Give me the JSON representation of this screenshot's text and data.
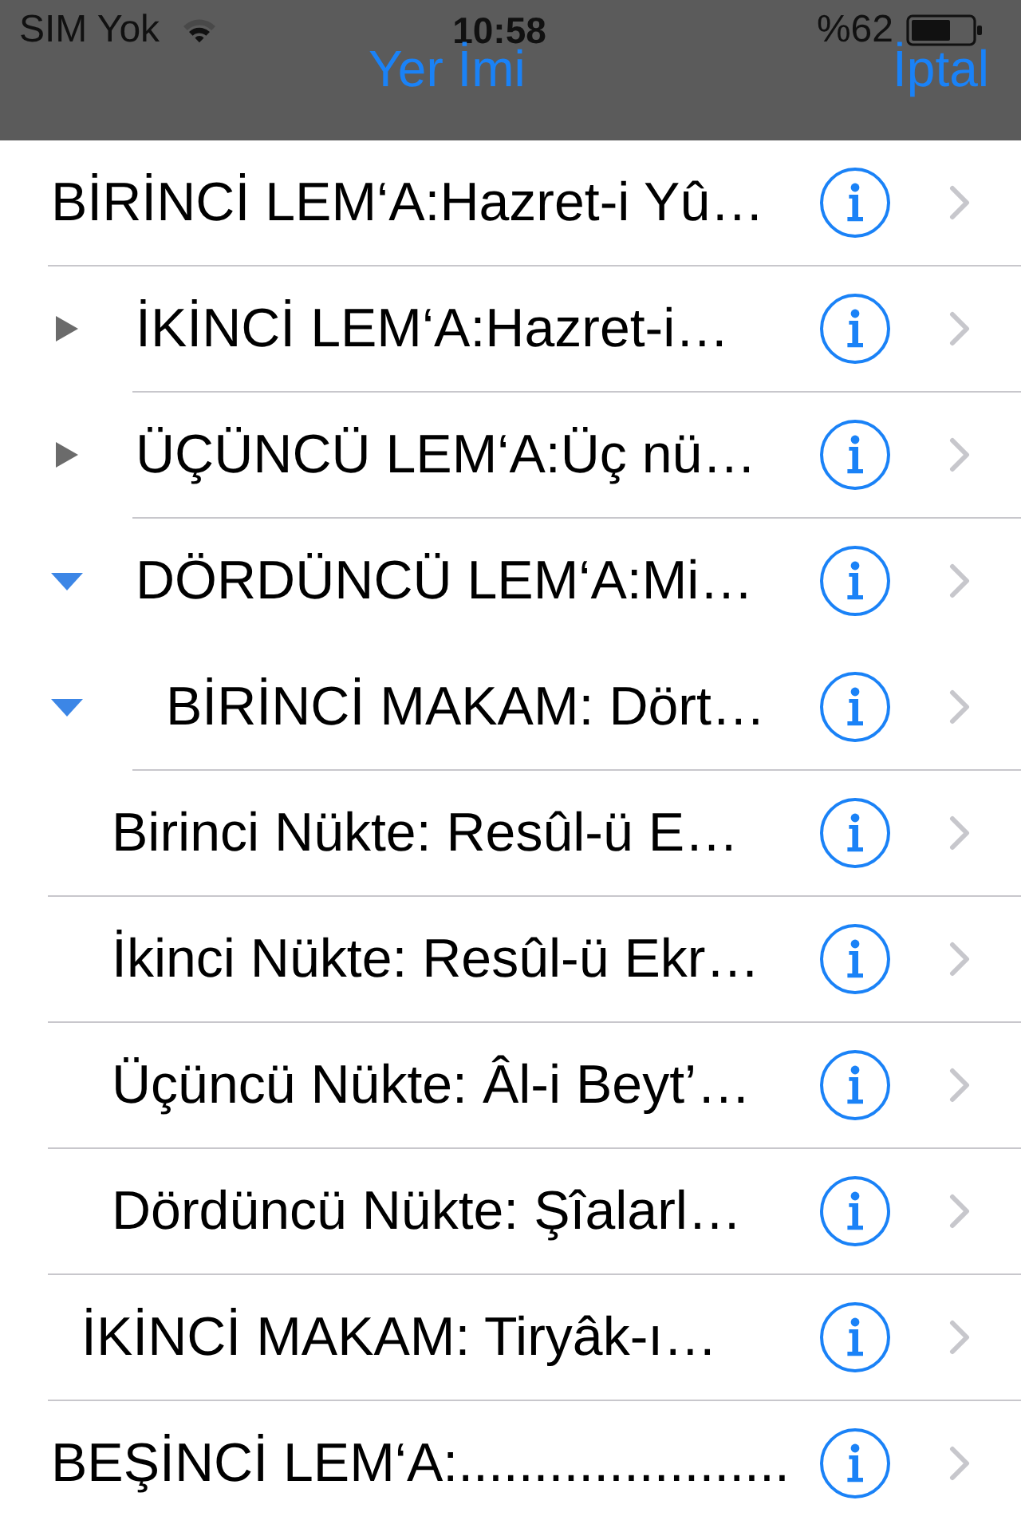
{
  "status_bar": {
    "carrier": "SIM Yok",
    "time": "10:58",
    "battery": "%62"
  },
  "nav_bar": {
    "title": "Yer İmi",
    "cancel": "İptal"
  },
  "outline": [
    {
      "title": "BİRİNCİ LEM‘A:Hazret-i Yû…",
      "separator": true
    },
    {
      "title": "İKİNCİ LEM‘A:Hazret-i…",
      "expanded": false,
      "separator": true
    },
    {
      "title": "ÜÇÜNCÜ LEM‘A:Üç nü…",
      "expanded": false,
      "separator": true
    },
    {
      "title": "DÖRDÜNCÜ LEM‘A:Mi…",
      "expanded": true,
      "separator": false,
      "children": [
        {
          "title": "BİRİNCİ MAKAM: Dört…",
          "expanded": true,
          "separator": true,
          "children": [
            {
              "title": "Birinci Nükte: Resûl-ü E…",
              "separator": true
            },
            {
              "title": "İkinci Nükte: Resûl-ü Ekr…",
              "separator": true
            },
            {
              "title": "Üçüncü Nükte: Âl-i Beyt’…",
              "separator": true
            },
            {
              "title": "Dördüncü Nükte: Şîalarl…",
              "separator": true
            }
          ]
        },
        {
          "title": "İKİNCİ MAKAM: Tiryâk-ı…",
          "separator": true
        }
      ]
    },
    {
      "title": "BEŞİNCİ LEM‘A:......................",
      "separator": false
    }
  ]
}
